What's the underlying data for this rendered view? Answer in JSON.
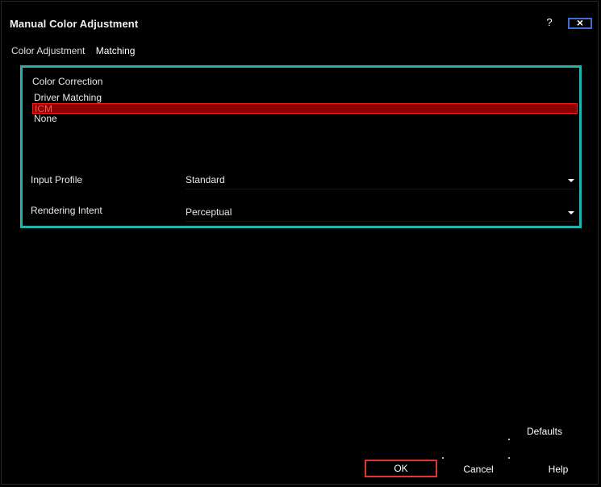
{
  "window": {
    "title": "Manual Color Adjustment",
    "help_glyph": "?",
    "close_glyph": "×"
  },
  "tabs": [
    {
      "label": "Color Adjustment",
      "active": false
    },
    {
      "label": "Matching",
      "active": true
    }
  ],
  "color_correction": {
    "label": "Color Correction",
    "options": [
      {
        "label": "Driver Matching",
        "selected": false
      },
      {
        "label": "ICM",
        "selected": true
      },
      {
        "label": "None",
        "selected": false
      }
    ]
  },
  "input_profile": {
    "label": "Input Profile",
    "value": "Standard"
  },
  "rendering_intent": {
    "label": "Rendering Intent",
    "value": "Perceptual"
  },
  "buttons": {
    "defaults": "Defaults",
    "ok": "OK",
    "cancel": "Cancel",
    "help": "Help"
  },
  "colors": {
    "group_border": "#1fb4ad",
    "selection_fill": "#8c0000",
    "selection_border": "#ff1a1a",
    "default_button_border": "#e3342f",
    "close_button_border": "#3a6fd0"
  }
}
